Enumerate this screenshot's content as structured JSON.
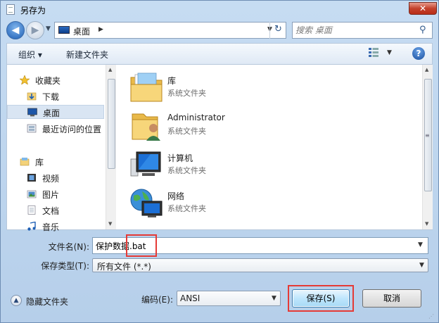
{
  "window": {
    "title": "另存为",
    "close_glyph": "✕"
  },
  "nav": {
    "back_glyph": "◀",
    "forward_glyph": "▶"
  },
  "address": {
    "crumb": "桌面",
    "crumb_arrow": "▶",
    "dropdown_glyph": "▼",
    "refresh_glyph": "↻"
  },
  "search": {
    "placeholder": "搜索 桌面",
    "icon_glyph": "⚲"
  },
  "toolbar": {
    "organize": "组织 ▾",
    "new_folder": "新建文件夹",
    "view_drop": "▼",
    "help": "?"
  },
  "sidebar": {
    "items": [
      {
        "label": "收藏夹",
        "icon": "favorites-star-icon"
      },
      {
        "label": "下载",
        "icon": "downloads-icon"
      },
      {
        "label": "桌面",
        "icon": "desktop-icon"
      },
      {
        "label": "最近访问的位置",
        "icon": "recent-places-icon"
      },
      {
        "label": "库",
        "icon": "libraries-icon"
      },
      {
        "label": "视频",
        "icon": "videos-icon"
      },
      {
        "label": "图片",
        "icon": "pictures-icon"
      },
      {
        "label": "文档",
        "icon": "documents-icon"
      },
      {
        "label": "音乐",
        "icon": "music-icon"
      }
    ]
  },
  "files": [
    {
      "name": "库",
      "type": "系统文件夹",
      "icon": "libraries-folder-icon"
    },
    {
      "name": "Administrator",
      "type": "系统文件夹",
      "icon": "user-folder-icon"
    },
    {
      "name": "计算机",
      "type": "系统文件夹",
      "icon": "computer-icon"
    },
    {
      "name": "网络",
      "type": "系统文件夹",
      "icon": "network-icon"
    }
  ],
  "form": {
    "filename_label": "文件名(N):",
    "filename_value": "保护数据.bat",
    "filetype_label": "保存类型(T):",
    "filetype_value": "所有文件  (*.*)",
    "dropdown_glyph": "▼"
  },
  "bottom": {
    "hide_folders": "隐藏文件夹",
    "encoding_label": "编码(E):",
    "encoding_value": "ANSI",
    "save_label": "保存(S)",
    "cancel_label": "取消"
  },
  "scroll": {
    "up": "▲",
    "down": "▼"
  },
  "colors": {
    "accent": "#3c7fb1",
    "highlight": "#e53a36",
    "selected": "#d9e5f3"
  }
}
